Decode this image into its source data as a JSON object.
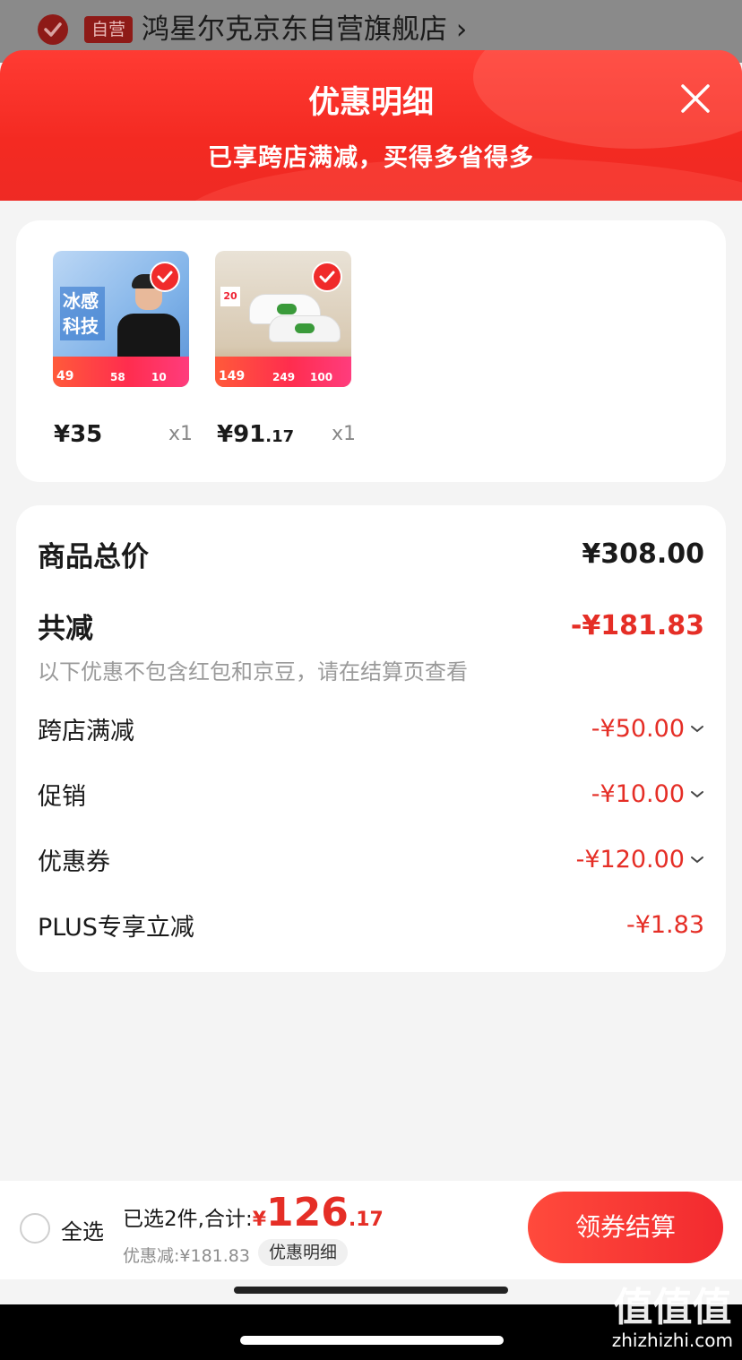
{
  "store": {
    "badge": "自营",
    "name": "鸿星尔克京东自营旗舰店 ›"
  },
  "sheet": {
    "title": "优惠明细",
    "subtitle": "已享跨店满减，买得多省得多"
  },
  "products": [
    {
      "thumb_text": "冰感科技",
      "promo_prices": [
        "49",
        "58",
        "10"
      ],
      "price": "¥35",
      "price_decimal": "",
      "qty": "x1"
    },
    {
      "thumb_text": "20",
      "promo_prices": [
        "149",
        "249",
        "100"
      ],
      "price": "¥91",
      "price_decimal": ".17",
      "qty": "x1"
    }
  ],
  "summary": {
    "total_label": "商品总价",
    "total_value": "¥308.00",
    "reduce_label": "共减",
    "reduce_value": "-¥181.83",
    "note": "以下优惠不包含红包和京豆，请在结算页查看",
    "items": [
      {
        "label": "跨店满减",
        "value": "-¥50.00"
      },
      {
        "label": "促销",
        "value": "-¥10.00"
      },
      {
        "label": "优惠券",
        "value": "-¥120.00"
      },
      {
        "label": "PLUS专享立减",
        "value": "-¥1.83"
      }
    ]
  },
  "bottom": {
    "select_all": "全选",
    "selected_text": "已选2件,合计:",
    "currency": "¥",
    "total_int": "126",
    "total_dec": ".17",
    "discount_text": "优惠减:¥181.83",
    "detail_chip": "优惠明细",
    "checkout": "领券结算"
  },
  "watermark": {
    "glyphs": "值值值",
    "domain": "zhizhizhi.com"
  },
  "colors": {
    "accent_red": "#e52e26",
    "header_red": "#f42a22"
  }
}
